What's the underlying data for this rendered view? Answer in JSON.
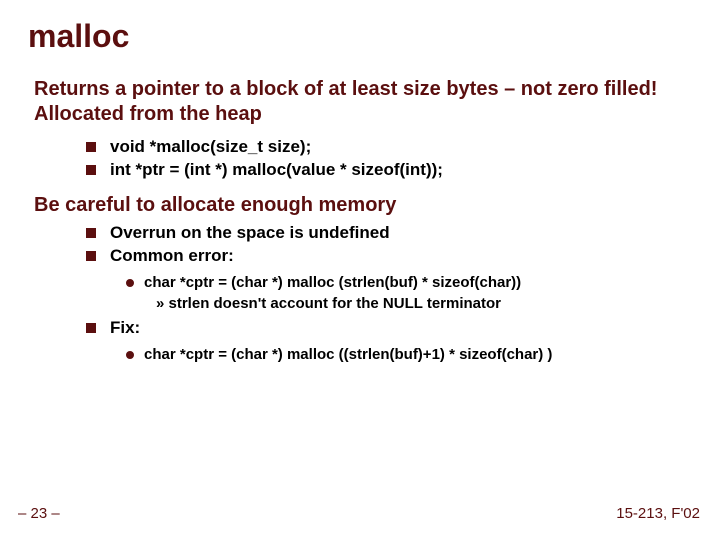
{
  "title": "malloc",
  "section1": {
    "heading": "Returns a pointer to a block of at least size bytes – not zero filled! Allocated from the heap",
    "items": [
      "void *malloc(size_t size);",
      "int *ptr = (int *) malloc(value * sizeof(int));"
    ]
  },
  "section2": {
    "heading": "Be careful to allocate enough memory",
    "items": [
      "Overrun on the space is undefined",
      "Common error:"
    ],
    "sub_items": [
      "char *cptr = (char *) malloc (strlen(buf) * sizeof(char))"
    ],
    "subsub_items": [
      "» strlen doesn't account for the NULL terminator"
    ],
    "fix_label": "Fix:",
    "fix_items": [
      "char *cptr = (char *) malloc ((strlen(buf)+1) * sizeof(char) )"
    ]
  },
  "footer": {
    "left": "– 23 –",
    "right": "15-213, F'02"
  }
}
